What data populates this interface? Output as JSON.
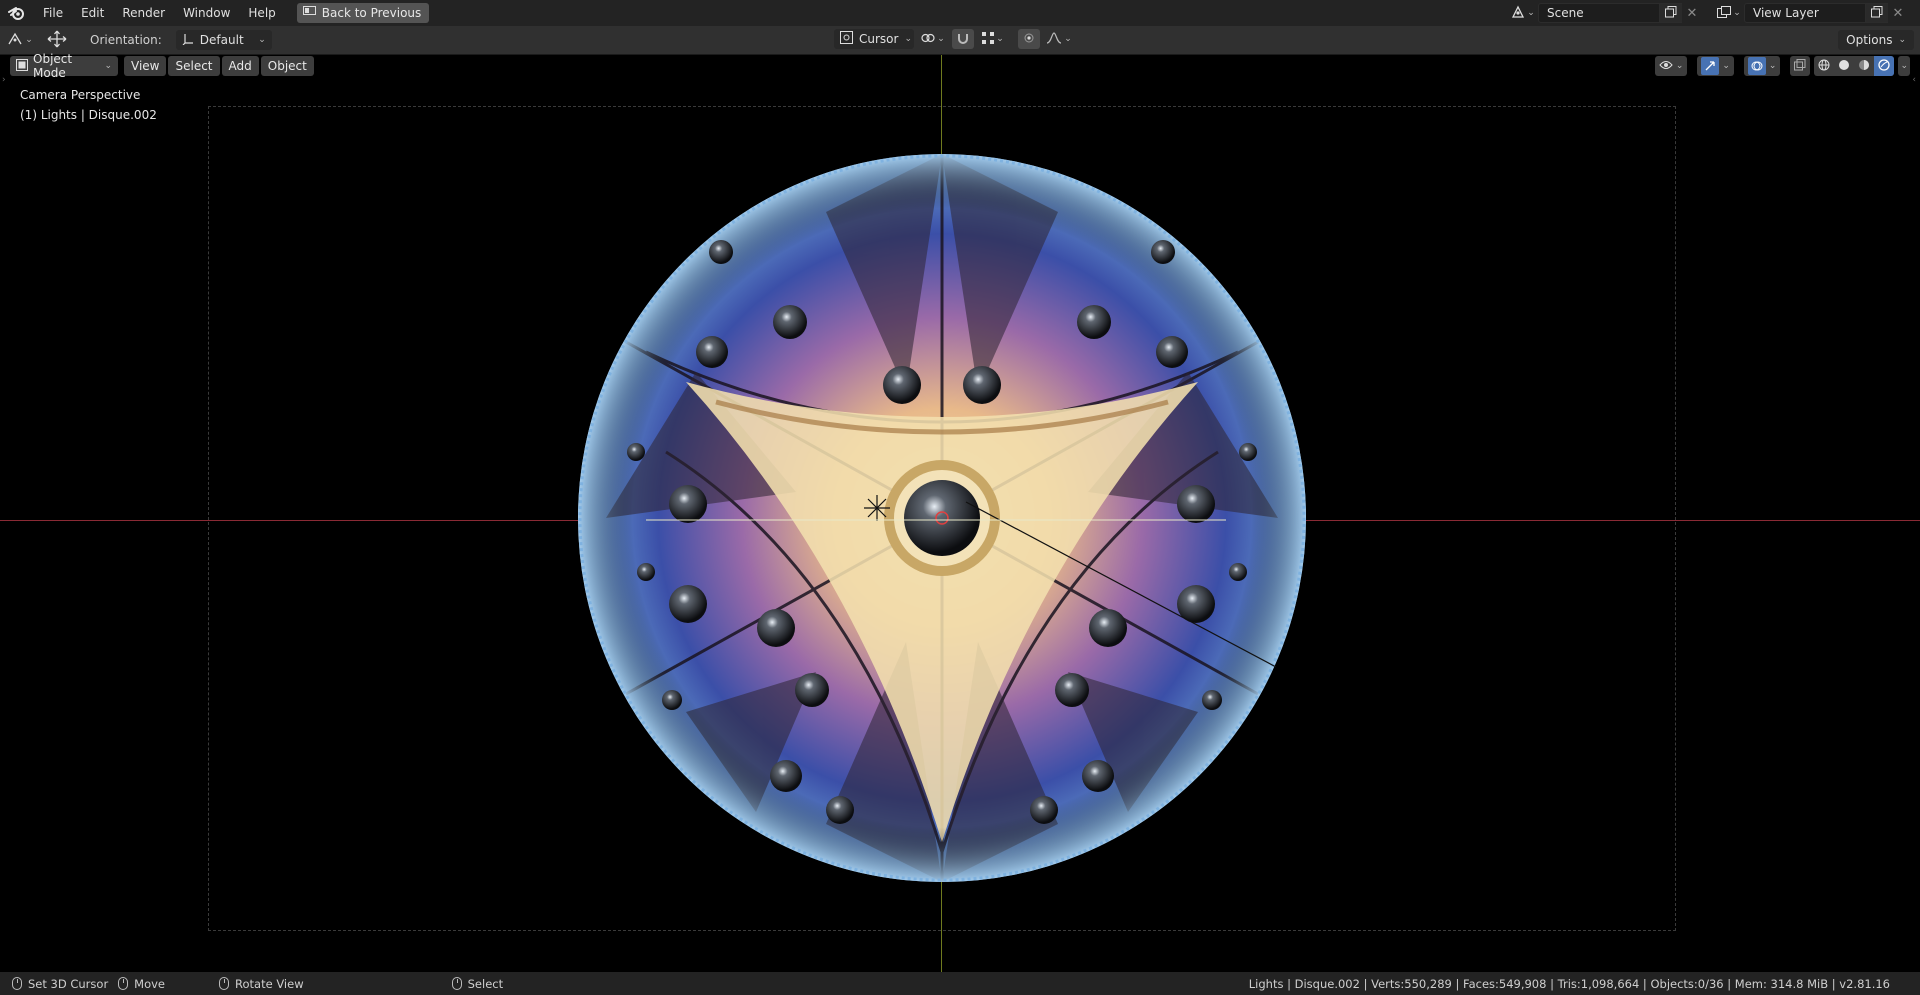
{
  "menubar": {
    "items": [
      "File",
      "Edit",
      "Render",
      "Window",
      "Help"
    ],
    "back_button": "Back to Previous",
    "scene_field": "Scene",
    "view_layer_field": "View Layer"
  },
  "toolheader": {
    "orientation_label": "Orientation:",
    "orientation_value": "Default",
    "pivot_value": "Cursor",
    "options_label": "Options"
  },
  "viewport_header": {
    "mode": "Object Mode",
    "menus": [
      "View",
      "Select",
      "Add",
      "Object"
    ]
  },
  "viewport": {
    "view_name": "Camera Perspective",
    "active_object": "(1) Lights | Disque.002"
  },
  "statusbar": {
    "set_cursor": "Set 3D Cursor",
    "move": "Move",
    "rotate_view": "Rotate View",
    "select": "Select",
    "stats": "Lights | Disque.002 | Verts:550,289 | Faces:549,908 | Tris:1,098,664 | Objects:0/36 | Mem: 314.8 MiB | v2.81.16"
  },
  "colors": {
    "header_bg": "#303030",
    "topbar_bg": "#232323",
    "accent_blue": "#4772b3",
    "axis_x": "#8a2a35",
    "axis_y": "#6f7a1f"
  }
}
